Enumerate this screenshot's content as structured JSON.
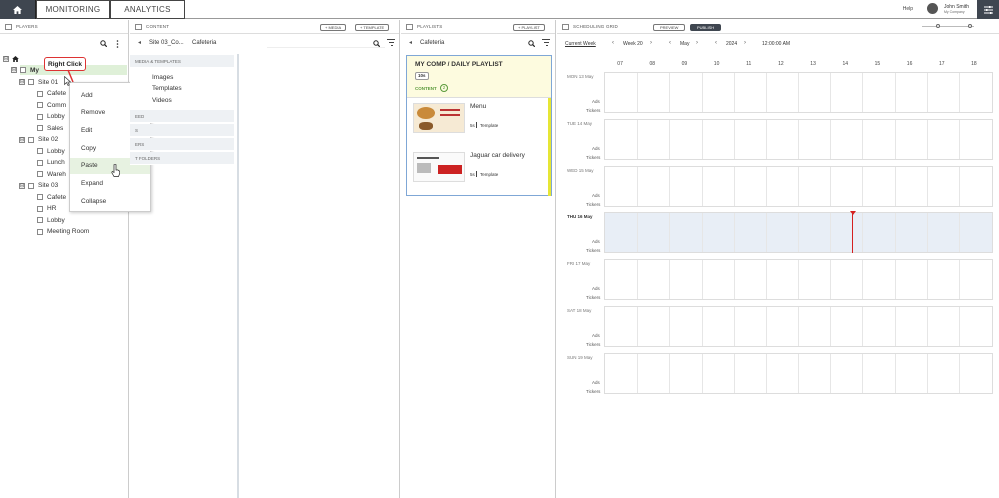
{
  "nav": {
    "tabs": [
      {
        "label": "MONITORING"
      },
      {
        "label": "ANALYTICS"
      }
    ],
    "help": "Help",
    "user": {
      "name": "John Smith",
      "company": "My Company"
    }
  },
  "players": {
    "header": "PLAYERS",
    "tree": {
      "root_label": "My",
      "sites": [
        {
          "label": "Site 01",
          "rooms": [
            "Cafete",
            "Comm",
            "Lobby",
            "Sales"
          ]
        },
        {
          "label": "Site 02",
          "rooms": [
            "Lobby",
            "Lunch",
            "Wareh"
          ]
        },
        {
          "label": "Site 03",
          "rooms": [
            "Cafete",
            "HR",
            "Lobby",
            "Meeting Room"
          ]
        }
      ]
    },
    "right_click_badge": "Right Click",
    "context_menu": [
      "Add",
      "Remove",
      "Edit",
      "Copy",
      "Paste",
      "Expand",
      "Collapse"
    ],
    "context_menu_highlighted": "Paste"
  },
  "content": {
    "header": "CONTENT",
    "btn_media": "+ MEDIA",
    "btn_template": "+ TEMPLATE",
    "breadcrumb_site": "Site 03_Co...",
    "breadcrumb_room": "Cafeteria",
    "category": "MEDIA & TEMPLATES",
    "sub_items": [
      "Images",
      "Templates",
      "Videos"
    ],
    "other_categories": [
      "EED",
      "S",
      "ERS",
      "T FOLDERS"
    ]
  },
  "playlists": {
    "header": "PLAYLISTS",
    "btn_add": "+ PLAYLIST",
    "breadcrumb": "Cafeteria",
    "card": {
      "title": "MY COMP /  DAILY PLAYLIST",
      "duration": "10s",
      "content_label": "CONTENT",
      "content_count": "2",
      "items": [
        {
          "name": "Menu",
          "duration": "5s",
          "type": "Template"
        },
        {
          "name": "Jaguar car delivery",
          "duration": "5s",
          "type": "Template"
        }
      ]
    }
  },
  "schedule": {
    "header": "SCHEDULING GRID",
    "btn_preview": "PREVIEW",
    "btn_publish": "PUBLISH",
    "current_week": "Current Week",
    "week": "Week 20",
    "month": "May",
    "year": "2024",
    "time": "12:00:00 AM",
    "hours": [
      "07",
      "08",
      "09",
      "10",
      "11",
      "12",
      "13",
      "14",
      "15",
      "16",
      "17",
      "18"
    ],
    "days": [
      "MON 13 May",
      "TUE 14 May",
      "WED 15 May",
      "THU 16 May",
      "FRI 17 May",
      "SAT 18 May",
      "SUN 19 May"
    ],
    "today": "THU 16 May",
    "row_labels": [
      "Ads",
      "Tickers"
    ],
    "accent": "#d42020"
  }
}
